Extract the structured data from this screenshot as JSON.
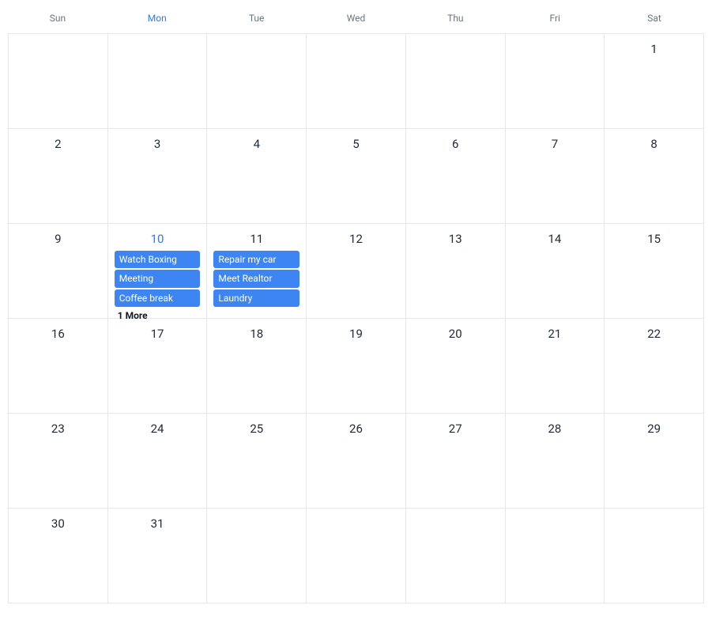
{
  "weekdays": [
    {
      "label": "Sun",
      "today": false
    },
    {
      "label": "Mon",
      "today": true
    },
    {
      "label": "Tue",
      "today": false
    },
    {
      "label": "Wed",
      "today": false
    },
    {
      "label": "Thu",
      "today": false
    },
    {
      "label": "Fri",
      "today": false
    },
    {
      "label": "Sat",
      "today": false
    }
  ],
  "cells": [
    {
      "day": null,
      "today": false,
      "events": [],
      "more": null
    },
    {
      "day": null,
      "today": false,
      "events": [],
      "more": null
    },
    {
      "day": null,
      "today": false,
      "events": [],
      "more": null
    },
    {
      "day": null,
      "today": false,
      "events": [],
      "more": null
    },
    {
      "day": null,
      "today": false,
      "events": [],
      "more": null
    },
    {
      "day": null,
      "today": false,
      "events": [],
      "more": null
    },
    {
      "day": "1",
      "today": false,
      "events": [],
      "more": null
    },
    {
      "day": "2",
      "today": false,
      "events": [],
      "more": null
    },
    {
      "day": "3",
      "today": false,
      "events": [],
      "more": null
    },
    {
      "day": "4",
      "today": false,
      "events": [],
      "more": null
    },
    {
      "day": "5",
      "today": false,
      "events": [],
      "more": null
    },
    {
      "day": "6",
      "today": false,
      "events": [],
      "more": null
    },
    {
      "day": "7",
      "today": false,
      "events": [],
      "more": null
    },
    {
      "day": "8",
      "today": false,
      "events": [],
      "more": null
    },
    {
      "day": "9",
      "today": false,
      "events": [],
      "more": null
    },
    {
      "day": "10",
      "today": true,
      "events": [
        "Watch Boxing",
        "Meeting",
        "Coffee break"
      ],
      "more": "1 More"
    },
    {
      "day": "11",
      "today": false,
      "events": [
        "Repair my car",
        "Meet Realtor",
        "Laundry"
      ],
      "more": null
    },
    {
      "day": "12",
      "today": false,
      "events": [],
      "more": null
    },
    {
      "day": "13",
      "today": false,
      "events": [],
      "more": null
    },
    {
      "day": "14",
      "today": false,
      "events": [],
      "more": null
    },
    {
      "day": "15",
      "today": false,
      "events": [],
      "more": null
    },
    {
      "day": "16",
      "today": false,
      "events": [],
      "more": null
    },
    {
      "day": "17",
      "today": false,
      "events": [],
      "more": null
    },
    {
      "day": "18",
      "today": false,
      "events": [],
      "more": null
    },
    {
      "day": "19",
      "today": false,
      "events": [],
      "more": null
    },
    {
      "day": "20",
      "today": false,
      "events": [],
      "more": null
    },
    {
      "day": "21",
      "today": false,
      "events": [],
      "more": null
    },
    {
      "day": "22",
      "today": false,
      "events": [],
      "more": null
    },
    {
      "day": "23",
      "today": false,
      "events": [],
      "more": null
    },
    {
      "day": "24",
      "today": false,
      "events": [],
      "more": null
    },
    {
      "day": "25",
      "today": false,
      "events": [],
      "more": null
    },
    {
      "day": "26",
      "today": false,
      "events": [],
      "more": null
    },
    {
      "day": "27",
      "today": false,
      "events": [],
      "more": null
    },
    {
      "day": "28",
      "today": false,
      "events": [],
      "more": null
    },
    {
      "day": "29",
      "today": false,
      "events": [],
      "more": null
    },
    {
      "day": "30",
      "today": false,
      "events": [],
      "more": null
    },
    {
      "day": "31",
      "today": false,
      "events": [],
      "more": null
    },
    {
      "day": null,
      "today": false,
      "events": [],
      "more": null
    },
    {
      "day": null,
      "today": false,
      "events": [],
      "more": null
    },
    {
      "day": null,
      "today": false,
      "events": [],
      "more": null
    },
    {
      "day": null,
      "today": false,
      "events": [],
      "more": null
    },
    {
      "day": null,
      "today": false,
      "events": [],
      "more": null
    }
  ]
}
